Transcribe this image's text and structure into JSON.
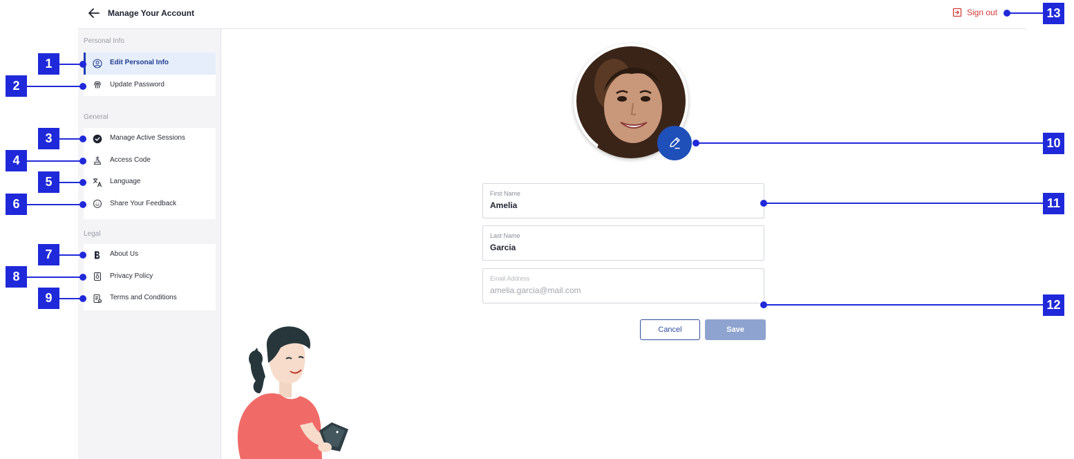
{
  "header": {
    "title": "Manage Your Account",
    "signout_label": "Sign out"
  },
  "sidebar": {
    "sections": [
      {
        "label": "Personal Info",
        "items": [
          {
            "label": "Edit Personal Info",
            "icon": "user-circle-icon",
            "active": true
          },
          {
            "label": "Update Password",
            "icon": "fingerprint-icon"
          }
        ]
      },
      {
        "label": "General",
        "items": [
          {
            "label": "Manage Active Sessions",
            "icon": "check-circle-icon"
          },
          {
            "label": "Access Code",
            "icon": "access-code-icon"
          },
          {
            "label": "Language",
            "icon": "translate-icon"
          },
          {
            "label": "Share Your Feedback",
            "icon": "feedback-icon"
          }
        ]
      },
      {
        "label": "Legal",
        "items": [
          {
            "label": "About Us",
            "icon": "brand-b-icon"
          },
          {
            "label": "Privacy Policy",
            "icon": "privacy-icon"
          },
          {
            "label": "Terms and Conditions",
            "icon": "terms-icon"
          }
        ]
      }
    ]
  },
  "form": {
    "first_name": {
      "label": "First Name",
      "value": "Amelia"
    },
    "last_name": {
      "label": "Last Name",
      "value": "Garcia"
    },
    "email": {
      "label": "Email Address",
      "value": "amelia.garcia@mail.com",
      "disabled": true
    },
    "cancel_label": "Cancel",
    "save_label": "Save"
  },
  "callouts": [
    "1",
    "2",
    "3",
    "4",
    "5",
    "6",
    "7",
    "8",
    "9",
    "10",
    "11",
    "12",
    "13"
  ],
  "colors": {
    "accent": "#1f4fb8",
    "callout": "#1f29d9",
    "signout": "#d33a3a",
    "active_bg": "#e6eefb",
    "save_disabled": "#8ea3cf"
  }
}
